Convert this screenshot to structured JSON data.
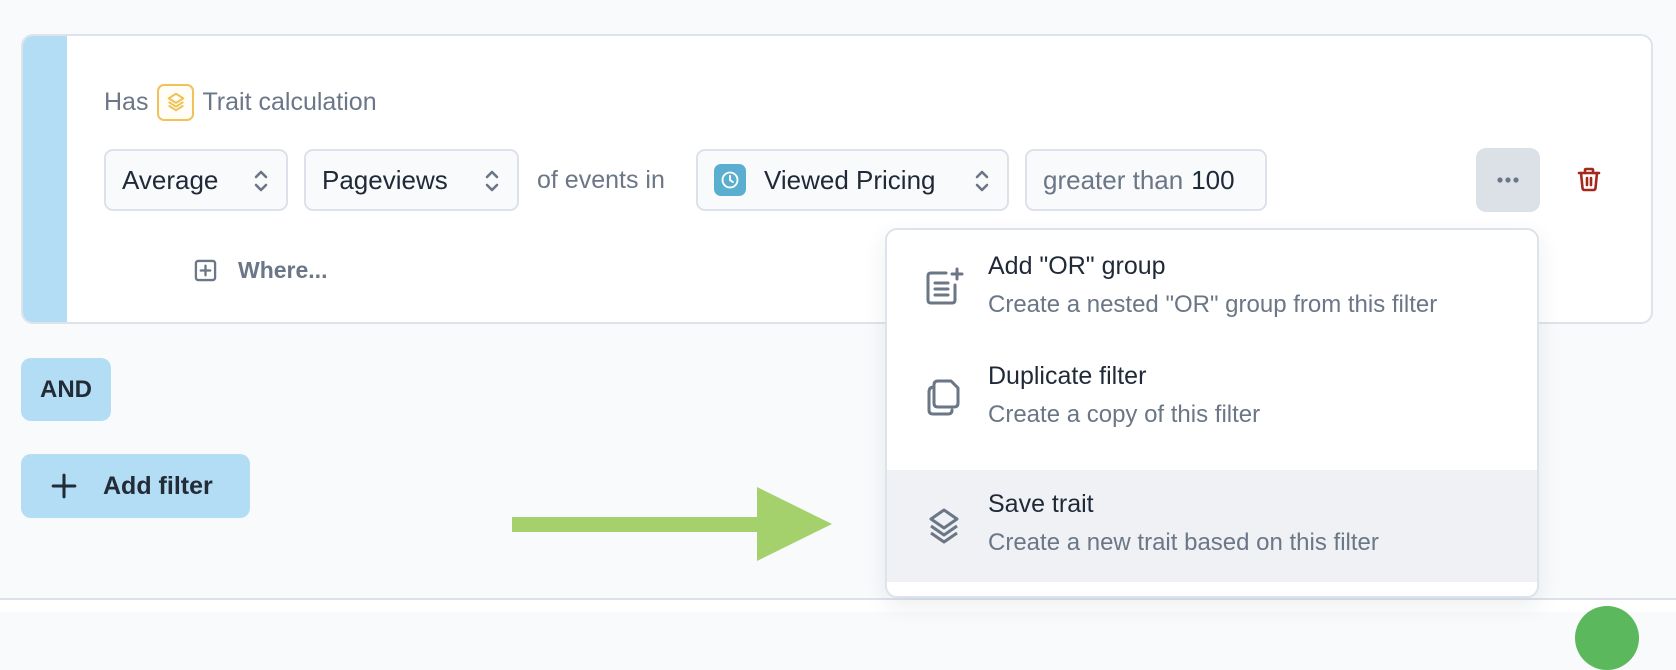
{
  "filter": {
    "prefix": "Has",
    "type_label": "Trait calculation",
    "type_icon": "layers-icon",
    "aggregation": {
      "value": "Average",
      "icon": "chevron-updown-icon"
    },
    "metric": {
      "value": "Pageviews",
      "icon": "chevron-updown-icon"
    },
    "connector_text": "of events in",
    "event": {
      "value": "Viewed Pricing",
      "icon": "clock-icon"
    },
    "condition": {
      "operator": "greater than",
      "value": "100"
    },
    "more_label": "...",
    "where_label": "Where..."
  },
  "logic_chip": "AND",
  "add_filter_label": "Add filter",
  "menu": {
    "items": [
      {
        "title": "Add \"OR\" group",
        "description": "Create a nested \"OR\" group from this filter",
        "icon": "note-plus-icon"
      },
      {
        "title": "Duplicate filter",
        "description": "Create a copy of this filter",
        "icon": "copy-icon"
      },
      {
        "title": "Save trait",
        "description": "Create a new trait based on this filter",
        "icon": "layers-icon",
        "highlighted": true
      }
    ]
  },
  "colors": {
    "accent_light_blue": "#b2ddf5",
    "trait_badge": "#f0c25c",
    "event_badge": "#5aafd0",
    "delete_red": "#a3281d",
    "arrow_green": "#a4d16c"
  }
}
